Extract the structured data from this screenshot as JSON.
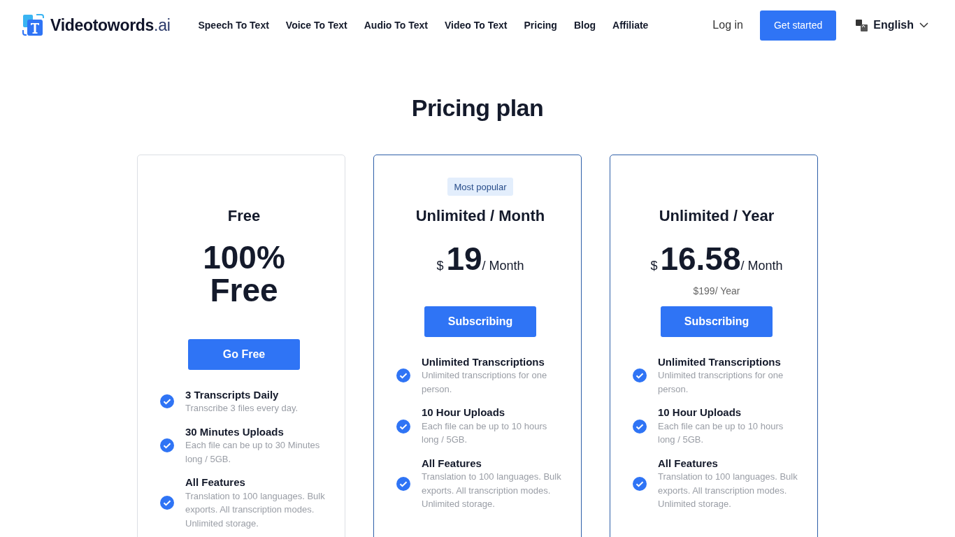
{
  "header": {
    "logo": "Videotowords",
    "logo_suffix": ".ai",
    "nav": [
      {
        "label": "Speech To Text"
      },
      {
        "label": "Voice To Text"
      },
      {
        "label": "Audio To Text"
      },
      {
        "label": "Video To Text"
      },
      {
        "label": "Pricing"
      },
      {
        "label": "Blog"
      },
      {
        "label": "Affiliate"
      }
    ],
    "login": "Log in",
    "cta": "Get started",
    "language": "English"
  },
  "title": "Pricing plan",
  "plans": [
    {
      "highlighted": false,
      "name": "Free",
      "kind": "text",
      "price": "100% Free",
      "button": "Go Free",
      "features": [
        {
          "title": "3 Transcripts Daily",
          "desc": "Transcribe 3 files every day."
        },
        {
          "title": "30 Minutes Uploads",
          "desc": "Each file can be up to 30 Minutes long / 5GB."
        },
        {
          "title": "All Features",
          "desc": "Translation to 100 languages. Bulk exports. All transcription modes. Unlimited storage."
        }
      ]
    },
    {
      "highlighted": true,
      "badge": "Most popular",
      "name": "Unlimited / Month",
      "kind": "amount",
      "currency": "$",
      "amount": "19",
      "period": "/ Month",
      "button": "Subscribing",
      "features": [
        {
          "title": "Unlimited Transcriptions",
          "desc": "Unlimited transcriptions for one person."
        },
        {
          "title": "10 Hour Uploads",
          "desc": "Each file can be up to 10 hours long / 5GB."
        },
        {
          "title": "All Features",
          "desc": "Translation to 100 languages. Bulk exports. All transcription modes. Unlimited storage."
        }
      ]
    },
    {
      "highlighted": true,
      "name": "Unlimited / Year",
      "kind": "amount",
      "currency": "$",
      "amount": "16.58",
      "period": "/ Month",
      "note": "$199/ Year",
      "button": "Subscribing",
      "features": [
        {
          "title": "Unlimited Transcriptions",
          "desc": "Unlimited transcriptions for one person."
        },
        {
          "title": "10 Hour Uploads",
          "desc": "Each file can be up to 10 hours long / 5GB."
        },
        {
          "title": "All Features",
          "desc": "Translation to 100 languages. Bulk exports. All transcription modes. Unlimited storage."
        }
      ]
    }
  ]
}
